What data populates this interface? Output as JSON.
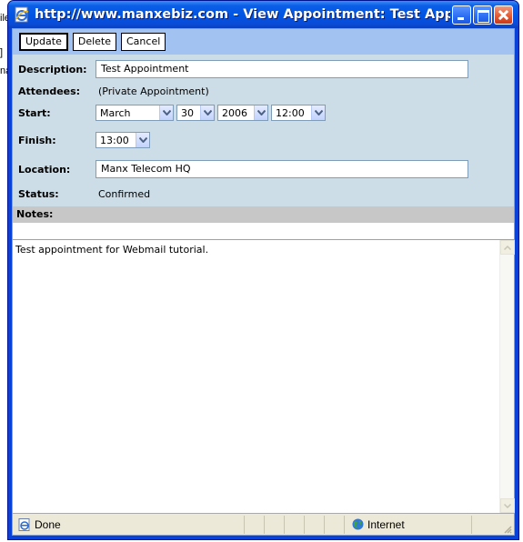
{
  "background": {
    "frag1": "ile",
    "frag2": "]",
    "frag3": "na"
  },
  "window": {
    "title": "http://www.manxebiz.com - View Appointment: Test Appointmen...",
    "icon": "ie-page-icon"
  },
  "toolbar": {
    "update_label": "Update",
    "delete_label": "Delete",
    "cancel_label": "Cancel"
  },
  "form": {
    "description": {
      "label": "Description:",
      "value": "Test Appointment"
    },
    "attendees": {
      "label": "Attendees:",
      "value": "(Private Appointment)"
    },
    "start": {
      "label": "Start:",
      "month": "March",
      "day": "30",
      "year": "2006",
      "time": "12:00"
    },
    "finish": {
      "label": "Finish:",
      "time": "13:00"
    },
    "location": {
      "label": "Location:",
      "value": "Manx Telecom HQ"
    },
    "status": {
      "label": "Status:",
      "value": "Confirmed"
    }
  },
  "notes": {
    "label": "Notes:",
    "text": "Test appointment for Webmail tutorial."
  },
  "statusbar": {
    "status_text": "Done",
    "zone_text": "Internet"
  }
}
